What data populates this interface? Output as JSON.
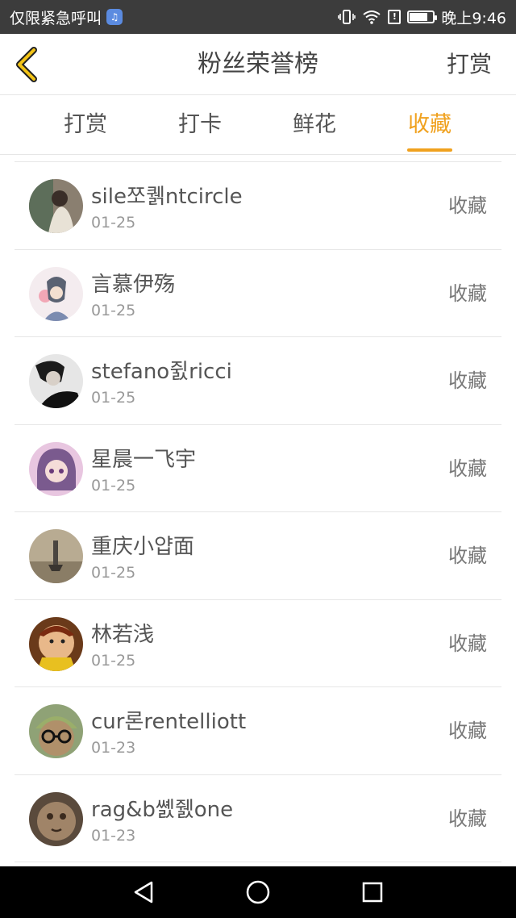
{
  "status_bar": {
    "left_text": "仅限紧急呼叫",
    "time": "晚上9:46",
    "icons": [
      "music-app-icon",
      "vibrate-icon",
      "wifi-icon",
      "alert-icon",
      "battery-icon"
    ]
  },
  "header": {
    "title": "粉丝荣誉榜",
    "back_icon": "chevron-left-icon",
    "action_label": "打赏"
  },
  "tabs": [
    {
      "label": "打赏",
      "active": false
    },
    {
      "label": "打卡",
      "active": false
    },
    {
      "label": "鲜花",
      "active": false
    },
    {
      "label": "收藏",
      "active": true
    }
  ],
  "list": [
    {
      "name": "sile쪼퀡ntcircle",
      "date": "01-25",
      "action": "收藏"
    },
    {
      "name": "言慕伊殇",
      "date": "01-25",
      "action": "收藏"
    },
    {
      "name": "stefano쥜ricci",
      "date": "01-25",
      "action": "收藏"
    },
    {
      "name": "星晨一飞宇",
      "date": "01-25",
      "action": "收藏"
    },
    {
      "name": "重庆小얍面",
      "date": "01-25",
      "action": "收藏"
    },
    {
      "name": "林若浅",
      "date": "01-25",
      "action": "收藏"
    },
    {
      "name": "cur론rentelliott",
      "date": "01-23",
      "action": "收藏"
    },
    {
      "name": "rag&b쏈쥀one",
      "date": "01-23",
      "action": "收藏"
    }
  ],
  "nav_bar": {
    "icons": [
      "back-triangle-icon",
      "home-circle-icon",
      "recents-square-icon"
    ]
  },
  "colors": {
    "accent": "#f0a11e",
    "status_bar": "#3c3c3c",
    "nav_bar": "#000000"
  }
}
